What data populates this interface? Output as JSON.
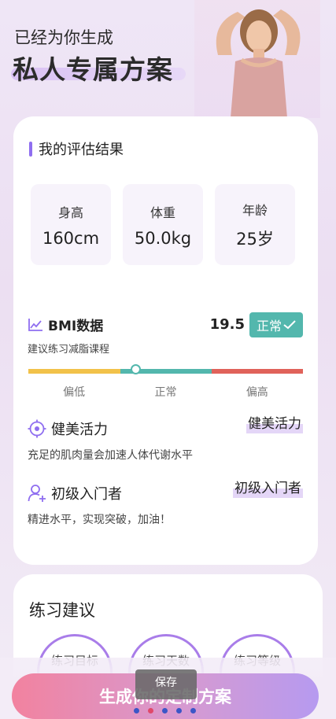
{
  "header": {
    "subtitle": "已经为你生成",
    "title": "私人专属方案"
  },
  "assessment": {
    "title": "我的评估结果",
    "stats": [
      {
        "label": "身高",
        "value": "160cm"
      },
      {
        "label": "体重",
        "value": "50.0kg"
      },
      {
        "label": "年龄",
        "value": "25岁"
      }
    ],
    "bmi": {
      "title": "BMI数据",
      "subtitle": "建议练习减脂课程",
      "score": "19.5",
      "status": "正常",
      "scale_labels": [
        "偏低",
        "正常",
        "偏高"
      ],
      "colors": {
        "low": "#f2c24a",
        "normal": "#53b7ad",
        "high": "#e0625a"
      }
    },
    "features": [
      {
        "title": "健美活力",
        "desc": "充足的肌肉量会加速人体代谢水平",
        "tag": "健美活力",
        "icon": "target-icon"
      },
      {
        "title": "初级入门者",
        "desc": "精进水平，实现突破，加油！",
        "tag": "初级入门者",
        "icon": "user-add-icon"
      }
    ]
  },
  "advice": {
    "title": "练习建议",
    "items": [
      "练习目标",
      "练习天数",
      "练习等级"
    ]
  },
  "footer": {
    "button_label": "生成你的定制方案",
    "save_tip": "保存",
    "dots": [
      "#3b56c7",
      "#e0486a",
      "#3b56c7",
      "#3b56c7",
      "#3b56c7"
    ]
  },
  "colors": {
    "accent": "#8f6ef0",
    "teal": "#53b7ad"
  }
}
